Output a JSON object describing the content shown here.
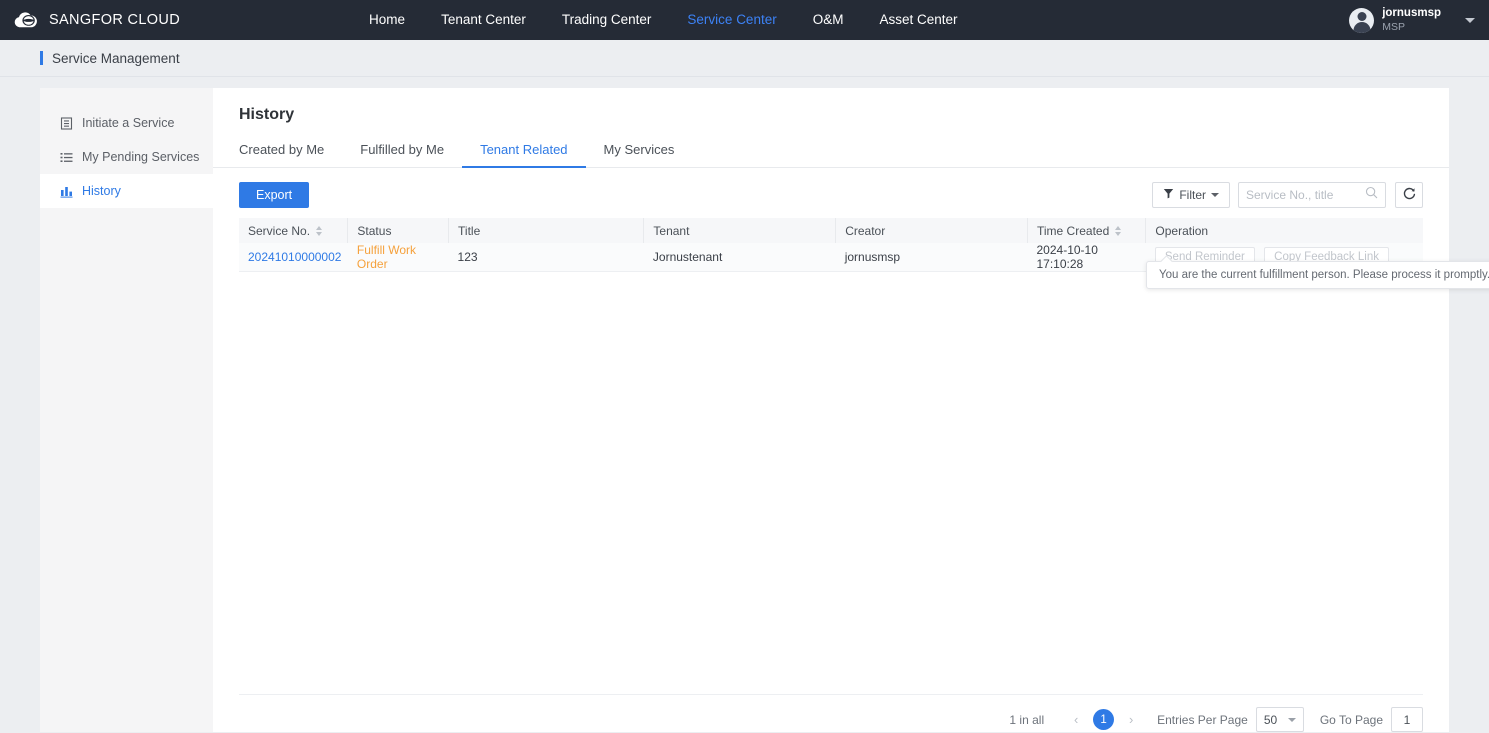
{
  "topbar": {
    "brand": "SANGFOR CLOUD",
    "logo_icon": "cloud-logo-icon",
    "nav": [
      {
        "label": "Home",
        "active": false
      },
      {
        "label": "Tenant Center",
        "active": false
      },
      {
        "label": "Trading Center",
        "active": false
      },
      {
        "label": "Service Center",
        "active": true
      },
      {
        "label": "O&M",
        "active": false
      },
      {
        "label": "Asset Center",
        "active": false
      }
    ],
    "user": {
      "name": "jornusmsp",
      "role": "MSP",
      "caret_icon": "chevron-down-icon"
    }
  },
  "breadcrumb": {
    "label": "Service Management"
  },
  "sidebar": {
    "items": [
      {
        "label": "Initiate a Service",
        "icon": "document-icon",
        "active": false
      },
      {
        "label": "My Pending Services",
        "icon": "list-icon",
        "active": false
      },
      {
        "label": "History",
        "icon": "bar-chart-icon",
        "active": true
      }
    ]
  },
  "main": {
    "title": "History",
    "tabs": [
      {
        "label": "Created by Me",
        "active": false
      },
      {
        "label": "Fulfilled by Me",
        "active": false
      },
      {
        "label": "Tenant Related",
        "active": true
      },
      {
        "label": "My Services",
        "active": false
      }
    ],
    "toolbar": {
      "export_label": "Export",
      "filter_label": "Filter",
      "filter_icon": "funnel-icon",
      "filter_caret_icon": "caret-down-icon",
      "search_placeholder": "Service No., title",
      "search_value": "",
      "search_icon": "search-icon",
      "refresh_icon": "refresh-icon"
    },
    "table": {
      "columns": [
        {
          "label": "Service No.",
          "sortable": true
        },
        {
          "label": "Status",
          "sortable": false
        },
        {
          "label": "Title",
          "sortable": false
        },
        {
          "label": "Tenant",
          "sortable": false
        },
        {
          "label": "Creator",
          "sortable": false
        },
        {
          "label": "Time Created",
          "sortable": true
        },
        {
          "label": "Operation",
          "sortable": false
        }
      ],
      "rows": [
        {
          "service_no": "20241010000002",
          "status": "Fulfill Work Order",
          "title": "123",
          "tenant": "Jornustenant",
          "creator": "jornusmsp",
          "time_created": "2024-10-10 17:10:28",
          "operations": [
            {
              "label": "Send Reminder",
              "disabled": true
            },
            {
              "label": "Copy Feedback Link",
              "disabled": true
            }
          ]
        }
      ]
    },
    "tooltip": {
      "text": "You are the current fulfillment person. Please process it promptly."
    },
    "pagination": {
      "total_text": "1 in all",
      "prev_icon": "chevron-left-icon",
      "next_icon": "chevron-right-icon",
      "current_page": "1",
      "per_page_label": "Entries Per Page",
      "per_page_value": "50",
      "goto_label": "Go To Page",
      "goto_value": "1"
    }
  },
  "colors": {
    "brand_dark": "#252b36",
    "accent_blue": "#2f7ae5",
    "status_orange": "#f5a13c",
    "page_bg": "#eceef1"
  }
}
